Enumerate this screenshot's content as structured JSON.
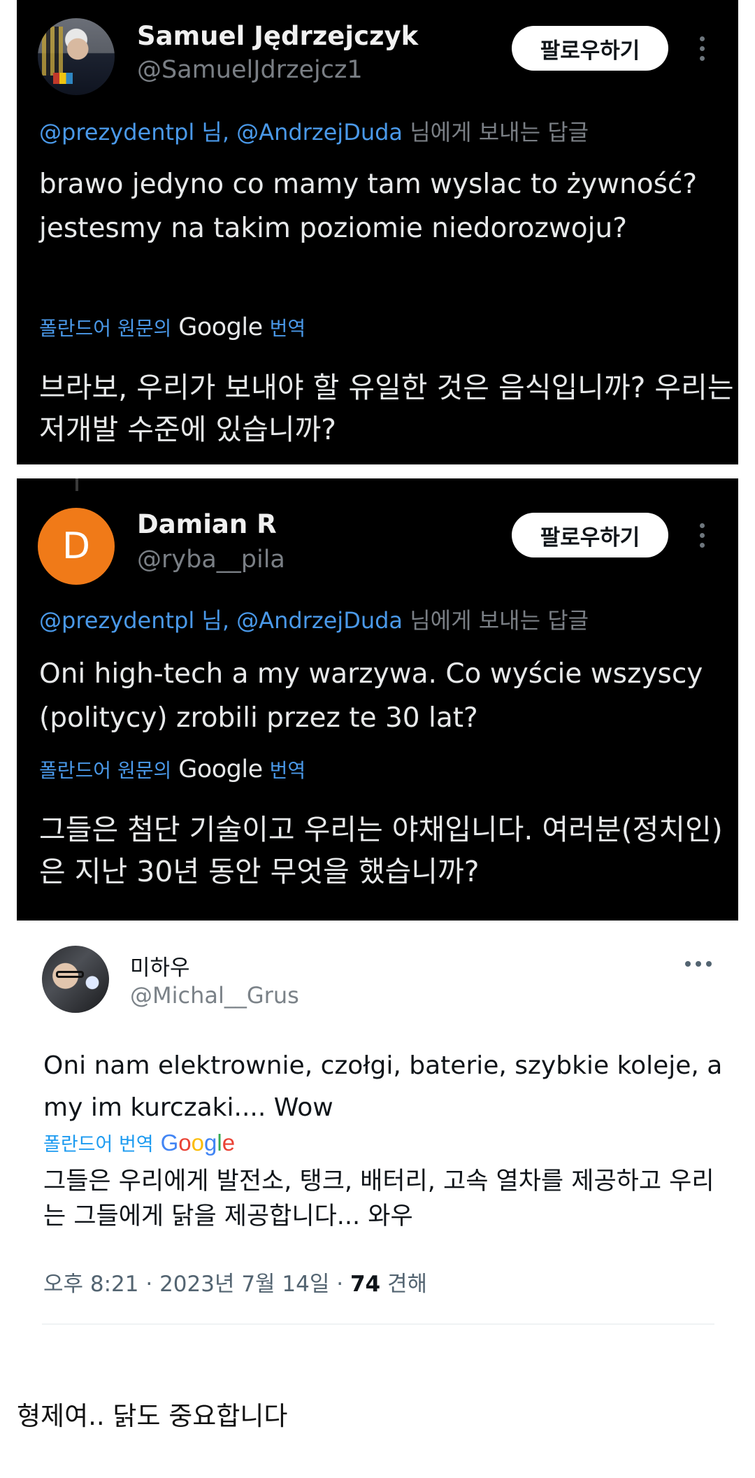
{
  "tweets": [
    {
      "name": "Samuel Jędrzejczyk",
      "handle": "@SamuelJdrzejcz1",
      "follow_label": "팔로우하기",
      "reply_mentions": "@prezydentpl 님, @AndrzejDuda",
      "reply_suffix": " 님에게 보내는 답글",
      "text": "brawo jedyno co mamy tam wyslac to żywność?  jestesmy na takim poziomie niedorozwoju?",
      "translate_prefix": "폴란드어 원문의",
      "translate_google": "Google",
      "translate_suffix": "번역",
      "translated": "브라보, 우리가 보내야 할 유일한 것은 음식입니까? 우리는 저개발 수준에 있습니까?"
    },
    {
      "name": "Damian R",
      "handle": "@ryba__pila",
      "avatar_letter": "D",
      "follow_label": "팔로우하기",
      "reply_mentions": "@prezydentpl 님, @AndrzejDuda",
      "reply_suffix": " 님에게 보내는 답글",
      "text": "Oni high-tech a my warzywa. Co wyście wszyscy (politycy) zrobili przez te 30 lat?",
      "translate_prefix": "폴란드어 원문의",
      "translate_google": "Google",
      "translate_suffix": "번역",
      "translated": "그들은 첨단 기술이고 우리는 야채입니다. 여러분(정치인)은 지난 30년 동안 무엇을 했습니까?"
    }
  ],
  "light_tweet": {
    "name": "미하우",
    "handle": "@Michal__Grus",
    "text": "Oni nam elektrownie, czołgi, baterie, szybkie koleje, a my im kurczaki.... Wow",
    "translate_label": "폴란드어 번역",
    "google_letters": [
      "G",
      "o",
      "o",
      "g",
      "l",
      "e"
    ],
    "translated": "그들은 우리에게 발전소, 탱크, 배터리, 고속 열차를 제공하고 우리는 그들에게 닭을 제공합니다... 와우",
    "time_date": "오후 8:21 · 2023년 7월 14일 · ",
    "views": "74",
    "views_label": " 견해"
  },
  "comment": "형제여.. 닭도 중요합니다",
  "colors": {
    "dark_bg": "#000000",
    "mention_blue": "#4a99e9",
    "twitter_blue": "#1d9bf0",
    "avatar_orange": "#f07a18"
  }
}
